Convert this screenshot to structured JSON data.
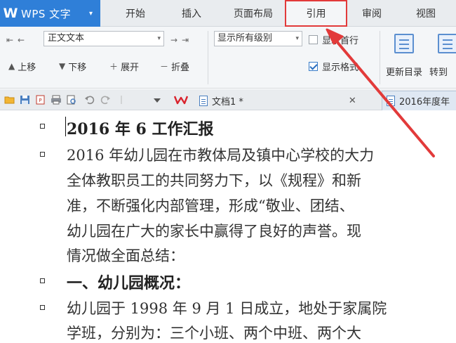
{
  "app": {
    "name": "WPS 文字"
  },
  "menu": {
    "tabs": [
      {
        "label": "开始"
      },
      {
        "label": "插入"
      },
      {
        "label": "页面布局"
      },
      {
        "label": "引用"
      },
      {
        "label": "审阅"
      },
      {
        "label": "视图"
      }
    ],
    "active_tab": "引用"
  },
  "ribbon": {
    "style_dropdown": {
      "value": "正文文本"
    },
    "levels_dropdown": {
      "value": "显示所有级别"
    },
    "show_first_line": {
      "label": "显示首行",
      "checked": false
    },
    "show_format": {
      "label": "显示格式",
      "checked": true
    },
    "move_up": {
      "label": "上移"
    },
    "move_down": {
      "label": "下移"
    },
    "expand": {
      "label": "展开"
    },
    "collapse": {
      "label": "折叠"
    },
    "update_toc": {
      "label": "更新目录"
    },
    "goto": {
      "label": "转到"
    }
  },
  "quickbar": {
    "tabs": [
      {
        "label": "文档1 *"
      },
      {
        "label": "2016年度年"
      }
    ]
  },
  "document": {
    "title": "2016 年 6 工作汇报",
    "para1": [
      "2016 年幼儿园在市教体局及镇中心学校的大力",
      "全体教职员工的共同努力下，以《规程》和新",
      "准，不断强化内部管理，形成“敬业、团结、",
      "幼儿园在广大的家长中赢得了良好的声誉。现",
      "情况做全面总结："
    ],
    "heading1": "一、幼儿园概况：",
    "para2": [
      "幼儿园于 1998 年 9 月 1 日成立，地处于家属院",
      "学班，分别为：三个小班、两个中班、两个大"
    ]
  },
  "colors": {
    "brand": "#2f7fd8",
    "highlight": "#e23a3a"
  },
  "icons": [
    "open-folder-icon",
    "save-icon",
    "pdf-export-icon",
    "print-icon",
    "print-preview-icon",
    "undo-icon",
    "redo-icon",
    "dropdown-icon",
    "wps-logo-icon",
    "document-icon",
    "close-icon"
  ]
}
